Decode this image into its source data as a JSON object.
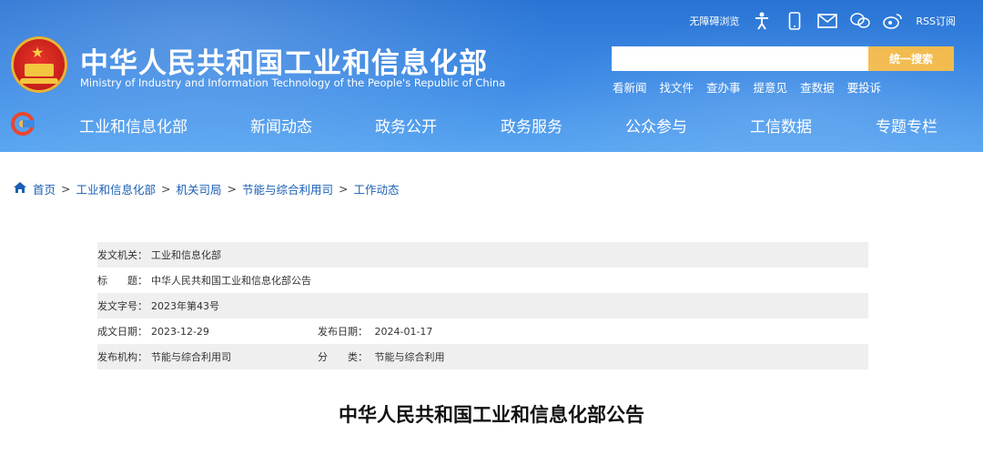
{
  "header": {
    "title_cn": "中华人民共和国工业和信息化部",
    "title_en": "Ministry of Industry and Information Technology of the People's Republic of China",
    "accessibility_label": "无障碍浏览",
    "rss_label": "RSS订阅",
    "search": {
      "placeholder": "",
      "button_label": "统一搜索"
    },
    "quick_links": [
      "看新闻",
      "找文件",
      "查办事",
      "提意见",
      "查数据",
      "要投诉"
    ]
  },
  "nav": {
    "items": [
      "工业和信息化部",
      "新闻动态",
      "政务公开",
      "政务服务",
      "公众参与",
      "工信数据",
      "专题专栏"
    ]
  },
  "breadcrumb": {
    "items": [
      "首页",
      "工业和信息化部",
      "机关司局",
      "节能与综合利用司",
      "工作动态"
    ],
    "separator": ">"
  },
  "doc_info": {
    "issuer_label": "发文机关：",
    "issuer_value": "工业和信息化部",
    "title_label": "标　　题：",
    "title_value": "中华人民共和国工业和信息化部公告",
    "doc_no_label": "发文字号：",
    "doc_no_value": "2023年第43号",
    "created_label": "成文日期：",
    "created_value": "2023-12-29",
    "published_label": "发布日期：",
    "published_value": "2024-01-17",
    "org_label": "发布机构：",
    "org_value": "节能与综合利用司",
    "category_label": "分　　类：",
    "category_value": "节能与综合利用"
  },
  "document": {
    "heading": "中华人民共和国工业和信息化部公告"
  },
  "colors": {
    "header_blue": "#2a74d4",
    "search_button": "#f2b94a",
    "link_blue": "#1a5fb4",
    "row_gray": "#efefef"
  }
}
